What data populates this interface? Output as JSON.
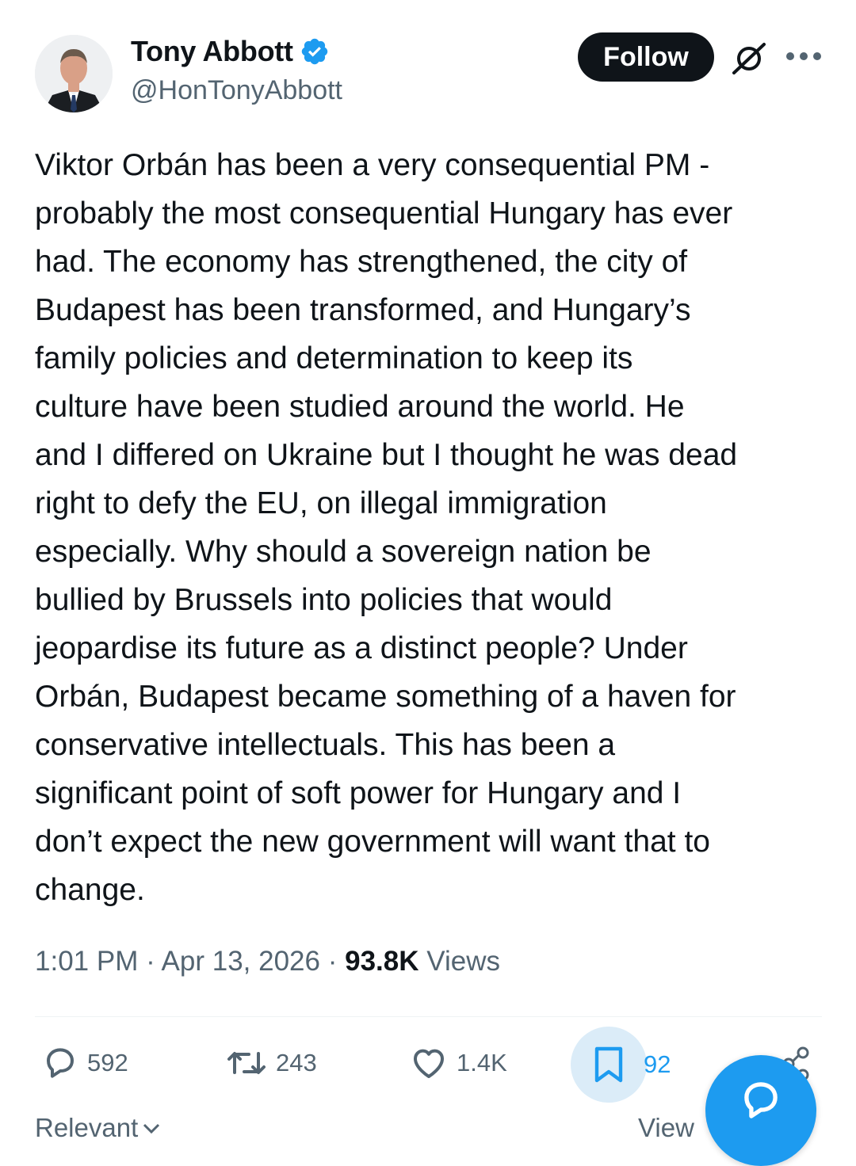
{
  "author": {
    "name": "Tony Abbott",
    "handle": "@HonTonyAbbott",
    "verified": true
  },
  "header": {
    "follow_label": "Follow"
  },
  "tweet": {
    "text": "Viktor Orbán has been a very consequential PM -\nprobably the most consequential Hungary has ever\nhad. The economy has strengthened, the city of\nBudapest has been transformed, and Hungary’s\nfamily policies and determination to keep its\nculture have been studied around the world. He\nand I differed on Ukraine but I thought he was dead\nright to defy the EU, on illegal immigration\nespecially. Why should a sovereign nation be\nbullied by Brussels into policies that would\njeopardise its future as a distinct people? Under\nOrbán, Budapest became something of a haven for\nconservative intellectuals. This has been a\nsignificant point of soft power for Hungary and I\ndon’t expect the new government will want that to\nchange.",
    "time": "1:01 PM",
    "date": "Apr 13, 2026",
    "views_count": "93.8K",
    "views_label": "Views"
  },
  "actions": {
    "replies": "592",
    "reposts": "243",
    "likes": "1.4K",
    "bookmarks": "92"
  },
  "footer": {
    "sort_label": "Relevant",
    "view_label": "View"
  },
  "colors": {
    "accent": "#1d9bf0",
    "text_primary": "#0f1419",
    "text_secondary": "#536471",
    "bookmark_highlight": "#dbecf8"
  },
  "icons": [
    "verified-badge-icon",
    "grok-icon",
    "more-icon",
    "reply-icon",
    "repost-icon",
    "like-icon",
    "bookmark-icon",
    "share-icon",
    "chevron-down-icon",
    "compose-reply-icon"
  ]
}
